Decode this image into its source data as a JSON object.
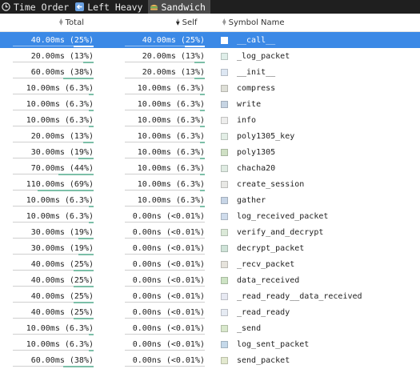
{
  "tabs": [
    {
      "label": "Time Order",
      "icon": "clock-icon",
      "active": false
    },
    {
      "label": "Left Heavy",
      "icon": "arrow-left-icon",
      "active": false
    },
    {
      "label": "Sandwich",
      "icon": "sandwich-icon",
      "active": true
    }
  ],
  "columns": {
    "total": "Total",
    "self": "Self",
    "name": "Symbol Name"
  },
  "rows": [
    {
      "total": "40.00ms (25%)",
      "total_pct": 25,
      "self": "40.00ms (25%)",
      "self_pct": 25,
      "name": "__call__",
      "color": "#d8dde2",
      "selected": true
    },
    {
      "total": "20.00ms (13%)",
      "total_pct": 13,
      "self": "20.00ms (13%)",
      "self_pct": 13,
      "name": "_log_packet",
      "color": "#dfeee9"
    },
    {
      "total": "60.00ms (38%)",
      "total_pct": 38,
      "self": "20.00ms (13%)",
      "self_pct": 13,
      "name": "__init__",
      "color": "#dde7f3"
    },
    {
      "total": "10.00ms (6.3%)",
      "total_pct": 6.3,
      "self": "10.00ms (6.3%)",
      "self_pct": 6.3,
      "name": "compress",
      "color": "#dedfd7"
    },
    {
      "total": "10.00ms (6.3%)",
      "total_pct": 6.3,
      "self": "10.00ms (6.3%)",
      "self_pct": 6.3,
      "name": "write",
      "color": "#c6d4e3"
    },
    {
      "total": "10.00ms (6.3%)",
      "total_pct": 6.3,
      "self": "10.00ms (6.3%)",
      "self_pct": 6.3,
      "name": "info",
      "color": "#ededec"
    },
    {
      "total": "20.00ms (13%)",
      "total_pct": 13,
      "self": "10.00ms (6.3%)",
      "self_pct": 6.3,
      "name": "poly1305_key",
      "color": "#e3eee6"
    },
    {
      "total": "30.00ms (19%)",
      "total_pct": 19,
      "self": "10.00ms (6.3%)",
      "self_pct": 6.3,
      "name": "poly1305",
      "color": "#cfe0c4"
    },
    {
      "total": "70.00ms (44%)",
      "total_pct": 44,
      "self": "10.00ms (6.3%)",
      "self_pct": 6.3,
      "name": "chacha20",
      "color": "#dfebe2"
    },
    {
      "total": "110.00ms (69%)",
      "total_pct": 69,
      "self": "10.00ms (6.3%)",
      "self_pct": 6.3,
      "name": "create_session",
      "color": "#e8e8e5"
    },
    {
      "total": "10.00ms (6.3%)",
      "total_pct": 6.3,
      "self": "10.00ms (6.3%)",
      "self_pct": 6.3,
      "name": "gather",
      "color": "#c7d5e6"
    },
    {
      "total": "10.00ms (6.3%)",
      "total_pct": 6.3,
      "self": "0.00ns (<0.01%)",
      "self_pct": 0,
      "name": "log_received_packet",
      "color": "#cfdcec"
    },
    {
      "total": "30.00ms (19%)",
      "total_pct": 19,
      "self": "0.00ns (<0.01%)",
      "self_pct": 0,
      "name": "verify_and_decrypt",
      "color": "#dbe9d8"
    },
    {
      "total": "30.00ms (19%)",
      "total_pct": 19,
      "self": "0.00ns (<0.01%)",
      "self_pct": 0,
      "name": "decrypt_packet",
      "color": "#cfe3d8"
    },
    {
      "total": "40.00ms (25%)",
      "total_pct": 25,
      "self": "0.00ns (<0.01%)",
      "self_pct": 0,
      "name": "_recv_packet",
      "color": "#e6e3dc"
    },
    {
      "total": "40.00ms (25%)",
      "total_pct": 25,
      "self": "0.00ns (<0.01%)",
      "self_pct": 0,
      "name": "data_received",
      "color": "#cde3c4"
    },
    {
      "total": "40.00ms (25%)",
      "total_pct": 25,
      "self": "0.00ns (<0.01%)",
      "self_pct": 0,
      "name": "_read_ready__data_received",
      "color": "#e7e9f2"
    },
    {
      "total": "40.00ms (25%)",
      "total_pct": 25,
      "self": "0.00ns (<0.01%)",
      "self_pct": 0,
      "name": "_read_ready",
      "color": "#e6ebf3"
    },
    {
      "total": "10.00ms (6.3%)",
      "total_pct": 6.3,
      "self": "0.00ns (<0.01%)",
      "self_pct": 0,
      "name": "_send",
      "color": "#d9e8cc"
    },
    {
      "total": "10.00ms (6.3%)",
      "total_pct": 6.3,
      "self": "0.00ns (<0.01%)",
      "self_pct": 0,
      "name": "log_sent_packet",
      "color": "#c5d9ea"
    },
    {
      "total": "60.00ms (38%)",
      "total_pct": 38,
      "self": "0.00ns (<0.01%)",
      "self_pct": 0,
      "name": "send_packet",
      "color": "#e3e9cf"
    }
  ]
}
